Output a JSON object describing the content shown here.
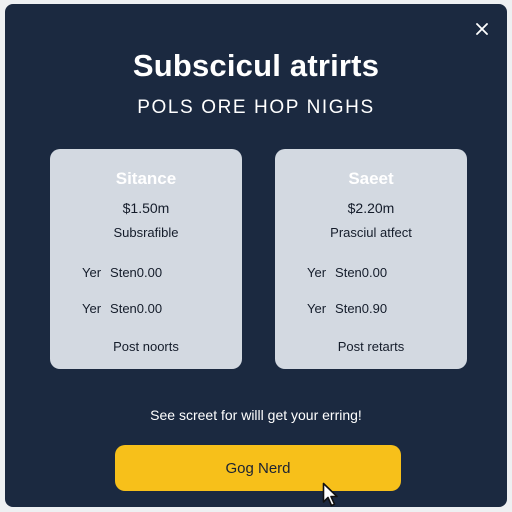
{
  "modal": {
    "title": "Subscicul atrirts",
    "subtitle": "POLS ORE HOP NIGHS",
    "close_icon": "close-icon"
  },
  "plans": [
    {
      "name": "Sitance",
      "price": "$1.50m",
      "description": "Subsrafible",
      "features": [
        {
          "key": "Yer",
          "value": "Sten0.00"
        },
        {
          "key": "Yer",
          "value": "Sten0.00"
        }
      ],
      "footer": "Post noorts"
    },
    {
      "name": "Saeet",
      "price": "$2.20m",
      "description": "Prasciul atfect",
      "features": [
        {
          "key": "Yer",
          "value": "Sten0.00"
        },
        {
          "key": "Yer",
          "value": "Sten0.90"
        }
      ],
      "footer": "Post retarts"
    }
  ],
  "note": "See screet for willl get your erring!",
  "cta": {
    "label": "Gog Nerd"
  },
  "colors": {
    "page_background": "#eef0f2",
    "modal_background": "#1b2940",
    "card_background": "#d3d9e1",
    "accent": "#f7c01a"
  },
  "icons": {
    "close": "close-icon",
    "cursor": "mouse-pointer-icon"
  }
}
